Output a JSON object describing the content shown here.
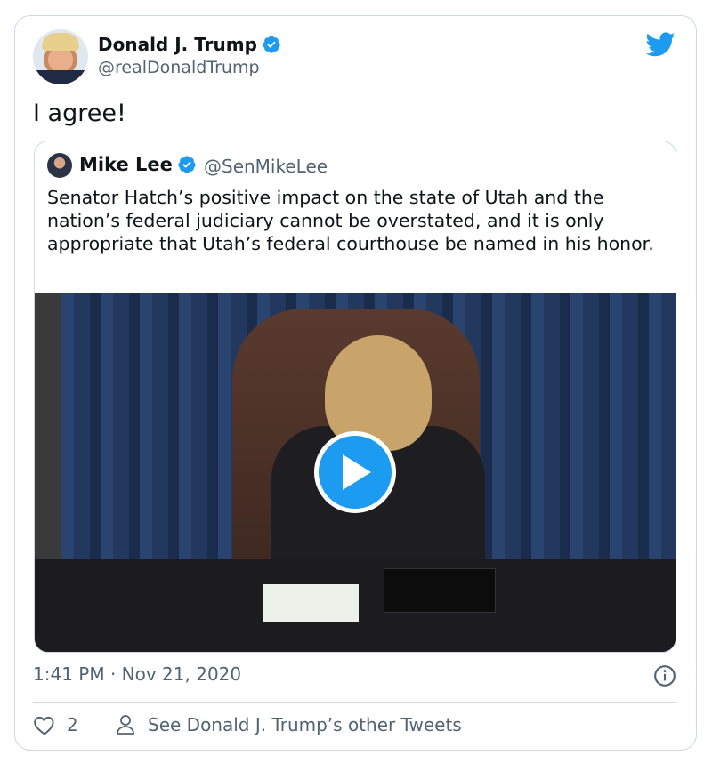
{
  "author": {
    "name": "Donald J. Trump",
    "handle": "@realDonaldTrump",
    "verified": true
  },
  "tweet": {
    "text": "I agree!",
    "timestamp": "1:41 PM · Nov 21, 2020"
  },
  "quoted": {
    "name": "Mike Lee",
    "handle": "@SenMikeLee",
    "verified": true,
    "text": "Senator Hatch’s positive impact on the state of Utah and the nation’s federal judiciary cannot be overstated, and it is only appropriate that Utah’s federal courthouse be named in his honor."
  },
  "actions": {
    "like_count": "2",
    "other_tweets_label": "See Donald J. Trump’s other Tweets"
  },
  "icons": {
    "brand": "twitter-bird-icon",
    "verified": "verified-badge-icon",
    "play": "play-icon",
    "info": "info-icon",
    "like": "heart-icon",
    "profile": "person-icon"
  },
  "colors": {
    "brand_blue": "#1d9bf0",
    "text_primary": "#0f1419",
    "text_secondary": "#536471",
    "border": "#cfd9de"
  }
}
